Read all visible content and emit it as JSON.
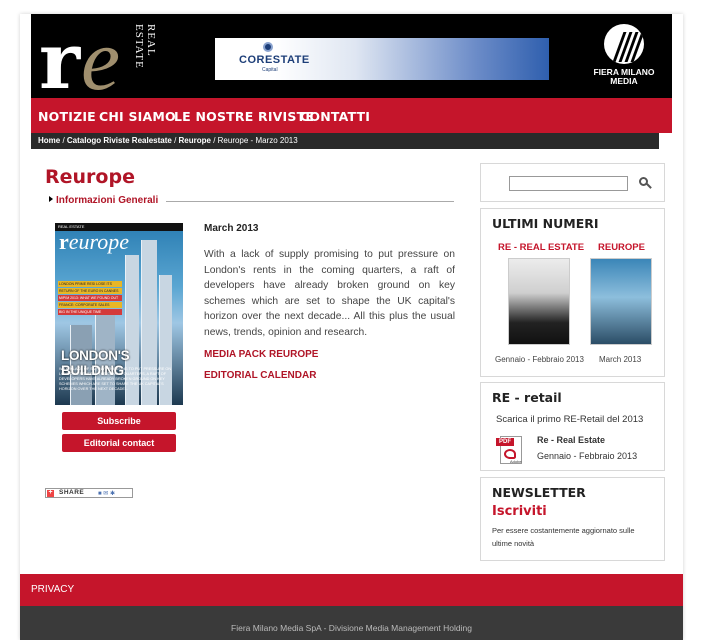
{
  "header": {
    "logo_letters": "re",
    "logo_side_text": "REAL ESTATE",
    "banner": {
      "brand": "CORESTATE",
      "sub": "Capital"
    },
    "partner_logo": {
      "line1": "FIERA MILANO",
      "line2": "MEDIA"
    }
  },
  "nav": {
    "items": [
      "NOTIZIE",
      "CHI SIAMO",
      "LE NOSTRE RIVISTE",
      "CONTATTI"
    ]
  },
  "breadcrumb": {
    "home": "Home",
    "catalog": "Catalogo Riviste Realestate",
    "section": "Reurope",
    "current": "Reurope - Marzo 2013",
    "sep": " / "
  },
  "main": {
    "title": "Reurope",
    "section_heading": "Informazioni Generali",
    "cover": {
      "top_label": "REAL ESTATE",
      "logo_r": "r",
      "logo_rest": "europe",
      "strip1": "LONDON PRIME RESI LOSE ITS CHARMS",
      "strip2": "RETURN OF THE EURO IN CANNES",
      "strip3": "MIPIM 2013: WHAT WE FOUND OUT THERE",
      "strip4": "FRANCE: CORPORATE SALES",
      "strip5": "BIG IN THE UNIQUE TIME",
      "headline": "LONDON'S BUILDING",
      "sub": "WITH A LACK OF SUPPLY PROMISING TO PUT PRESSURE ON LONDON'S RENTS IN THE COMING QUARTERS, A RAFT OF DEVELOPERS HAVE ALREADY BROKEN GROUND ON KEY SCHEMES WHICH ARE SET TO SHAPE THE UK CAPITAL'S HORIZON OVER THE NEXT DECADE..."
    },
    "subscribe_label": "Subscribe",
    "editorial_contact_label": "Editorial contact",
    "date": "March 2013",
    "body": "With a lack of supply promising to put pressure on London's rents in the coming quarters, a raft of developers have already broken ground on key schemes which are set to shape the UK capital's horizon over the next decade... All this plus the usual news, trends, opinion and research.",
    "link_media_pack": "MEDIA PACK REUROPE",
    "link_calendar": "EDITORIAL CALENDAR",
    "share_label": "SHARE"
  },
  "sidebar": {
    "search": {
      "value": "",
      "placeholder": ""
    },
    "latest": {
      "title": "ULTIMI NUMERI",
      "issues": [
        {
          "label": "RE - REAL ESTATE",
          "date": "Gennaio - Febbraio 2013"
        },
        {
          "label": "REUROPE",
          "date": "March 2013"
        }
      ]
    },
    "retail": {
      "title": "RE - retail",
      "desc": "Scarica il primo RE-Retail del 2013",
      "pdf_tag": "PDF",
      "pdf_brand": "Adobe",
      "item_title": "Re - Real Estate",
      "item_date": "Gennaio - Febbraio 2013"
    },
    "newsletter": {
      "title": "NEWSLETTER",
      "link": "Iscriviti",
      "desc": "Per essere costantemente aggiornato sulle ultime novità"
    }
  },
  "footer": {
    "privacy": "PRIVACY",
    "company": "Fiera Milano Media SpA - Divisione Media Management Holding"
  },
  "colors": {
    "brand_red": "#c5152b",
    "dark": "#2a2a2a",
    "gold": "#a08f6e"
  },
  "icons": [
    "search-icon",
    "pdf-icon",
    "share-plus-icon",
    "triangle-bullet-icon"
  ]
}
